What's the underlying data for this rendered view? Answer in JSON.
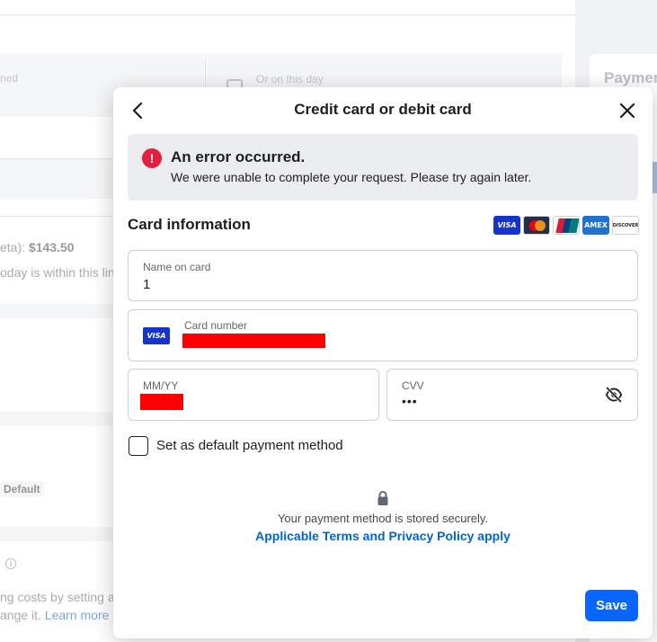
{
  "background": {
    "grayrow_left_text": "ned",
    "grayrow_right_text": "Or on this day",
    "balance_text": "eta): ",
    "balance_amount": "$143.50",
    "limit_text": "oday is within this lin",
    "default_chip": "Default",
    "info_icon": "i",
    "costs_text": "ng costs by setting a",
    "learn_prefix": "ange it. ",
    "learn_link": "Learn more a",
    "right_title": "Paymen"
  },
  "modal": {
    "title": "Credit card or debit card",
    "back_icon": "chevron-left-icon",
    "close_icon": "close-icon",
    "error": {
      "icon": "!",
      "title": "An error occurred.",
      "message": "We were unable to complete your request. Please try again later."
    },
    "section_title": "Card information",
    "card_logos": [
      {
        "name": "visa-logo",
        "text": "VISA"
      },
      {
        "name": "mastercard-logo",
        "text": ""
      },
      {
        "name": "unionpay-logo",
        "text": ""
      },
      {
        "name": "amex-logo",
        "text": "AMEX"
      },
      {
        "name": "discover-logo",
        "text": "DISCOVER"
      }
    ],
    "fields": {
      "name_on_card": {
        "label": "Name on card",
        "value": "1"
      },
      "card_number": {
        "label": "Card number",
        "value": "",
        "brand": "VISA",
        "redacted": true
      },
      "expiry": {
        "label": "MM/YY",
        "value": "",
        "redacted": true
      },
      "cvv": {
        "label": "CVV",
        "value": "•••",
        "toggle_icon": "eye-slash-icon"
      }
    },
    "default_checkbox": {
      "label": "Set as default payment method",
      "checked": false
    },
    "secure_text": "Your payment method is stored securely.",
    "terms_link": "Applicable Terms and Privacy Policy apply",
    "save_label": "Save"
  },
  "colors": {
    "primary": "#0866ff",
    "link": "#0064d1",
    "error": "#e41e3f",
    "error_bg": "#ebedf0",
    "redaction": "#ff0000"
  }
}
